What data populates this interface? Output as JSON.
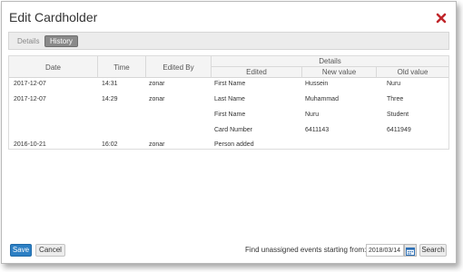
{
  "dialog": {
    "title": "Edit Cardholder",
    "close_icon": "close-icon",
    "accent_close": "#c0262b"
  },
  "tabs": {
    "details": "Details",
    "history": "History",
    "active": "History"
  },
  "table": {
    "headers": {
      "date": "Date",
      "time": "Time",
      "edited_by": "Edited By",
      "details_group": "Details",
      "edited": "Edited",
      "new_value": "New value",
      "old_value": "Old value"
    },
    "rows": [
      {
        "date": "2017-12-07",
        "time": "14:31",
        "edited_by": "zonar",
        "edited": "First Name",
        "new_value": "Hussein",
        "old_value": "Nuru"
      },
      {
        "date": "2017-12-07",
        "time": "14:29",
        "edited_by": "zonar",
        "edited": "Last Name",
        "new_value": "Muhammad",
        "old_value": "Three"
      },
      {
        "date": "",
        "time": "",
        "edited_by": "",
        "edited": "First Name",
        "new_value": "Nuru",
        "old_value": "Student"
      },
      {
        "date": "",
        "time": "",
        "edited_by": "",
        "edited": "Card Number",
        "new_value": "6411143",
        "old_value": "6411949"
      },
      {
        "date": "2016-10-21",
        "time": "16:02",
        "edited_by": "zonar",
        "edited": "Person added",
        "new_value": "",
        "old_value": ""
      }
    ]
  },
  "footer": {
    "save_label": "Save",
    "cancel_label": "Cancel",
    "find_label": "Find unassigned events starting from:",
    "date_value": "2018/03/14",
    "calendar_icon": "calendar-icon",
    "search_label": "Search"
  },
  "colors": {
    "primary_button": "#2c7fc4",
    "active_tab": "#8a8a8a",
    "calendar_icon": "#2c6fb5"
  }
}
